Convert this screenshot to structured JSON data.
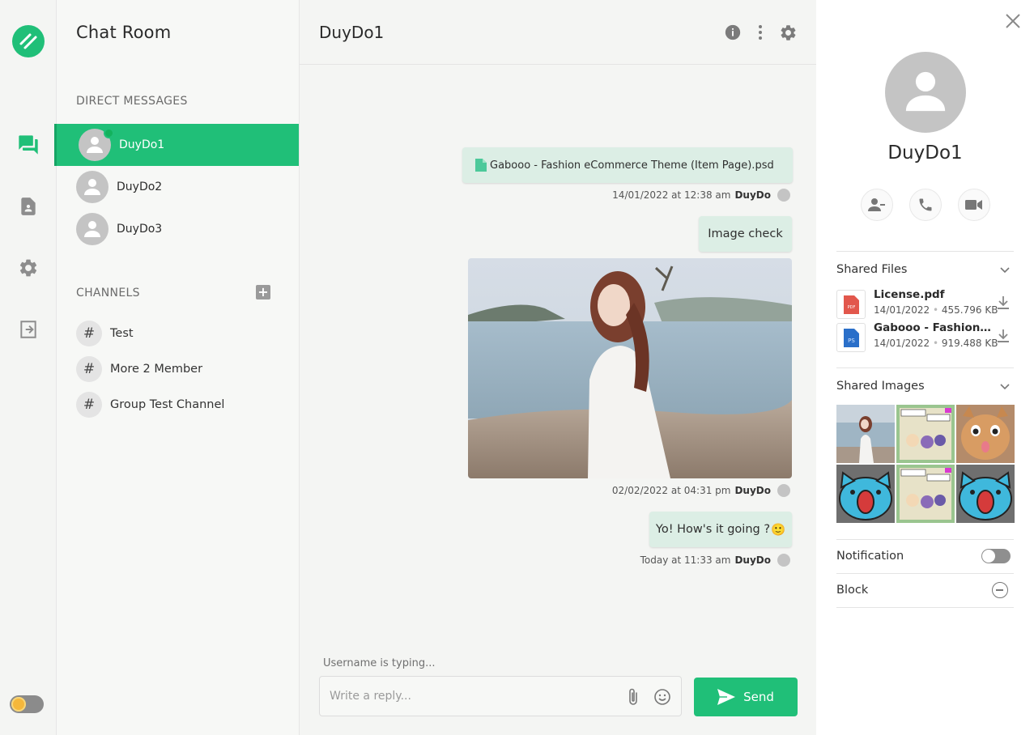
{
  "colors": {
    "brand": "#20bf78",
    "bubble": "#dceee5",
    "online": "#13b25d"
  },
  "rail": {
    "items": [
      {
        "name": "chats",
        "icon": "chat-bubbles-icon",
        "active": true
      },
      {
        "name": "contacts",
        "icon": "contact-card-icon"
      },
      {
        "name": "settings",
        "icon": "gear-icon"
      },
      {
        "name": "logout",
        "icon": "logout-icon"
      }
    ]
  },
  "sidebar": {
    "title": "Chat Room",
    "dm_label": "DIRECT MESSAGES",
    "dms": [
      {
        "name": "DuyDo1",
        "active": true,
        "online": true
      },
      {
        "name": "DuyDo2"
      },
      {
        "name": "DuyDo3"
      }
    ],
    "channels_label": "CHANNELS",
    "channels": [
      {
        "hash": "#",
        "name": "Test"
      },
      {
        "hash": "#",
        "name": "More 2 Member"
      },
      {
        "hash": "#",
        "name": "Group Test Channel"
      }
    ]
  },
  "chat": {
    "name": "DuyDo1",
    "messages": [
      {
        "type": "file",
        "text": "Gabooo - Fashion eCommerce Theme (Item Page).psd"
      },
      {
        "type": "meta",
        "time": "14/01/2022 at 12:38 am",
        "author": "DuyDo"
      },
      {
        "type": "text",
        "text": "Image check"
      },
      {
        "type": "meta",
        "time": "02/02/2022 at 04:31 pm",
        "author": "DuyDo"
      },
      {
        "type": "text",
        "text": "Yo! How's it going ?",
        "emoji": "🙂"
      },
      {
        "type": "meta",
        "time": "Today at 11:33 am",
        "author": "DuyDo"
      }
    ],
    "typing": "Username is typing...",
    "composer_placeholder": "Write a reply...",
    "send_label": "Send"
  },
  "panel": {
    "name": "DuyDo1",
    "shared_files_label": "Shared Files",
    "files": [
      {
        "name": "License.pdf",
        "date": "14/01/2022",
        "size": "455.796 KB",
        "kind": "PDF"
      },
      {
        "name": "Gabooo - Fashion eCommerce Theme (Item Page).psd",
        "date": "14/01/2022",
        "size": "919.488 KB",
        "kind": "PS"
      }
    ],
    "shared_images_label": "Shared Images",
    "notification_label": "Notification",
    "notification_on": false,
    "block_label": "Block"
  }
}
